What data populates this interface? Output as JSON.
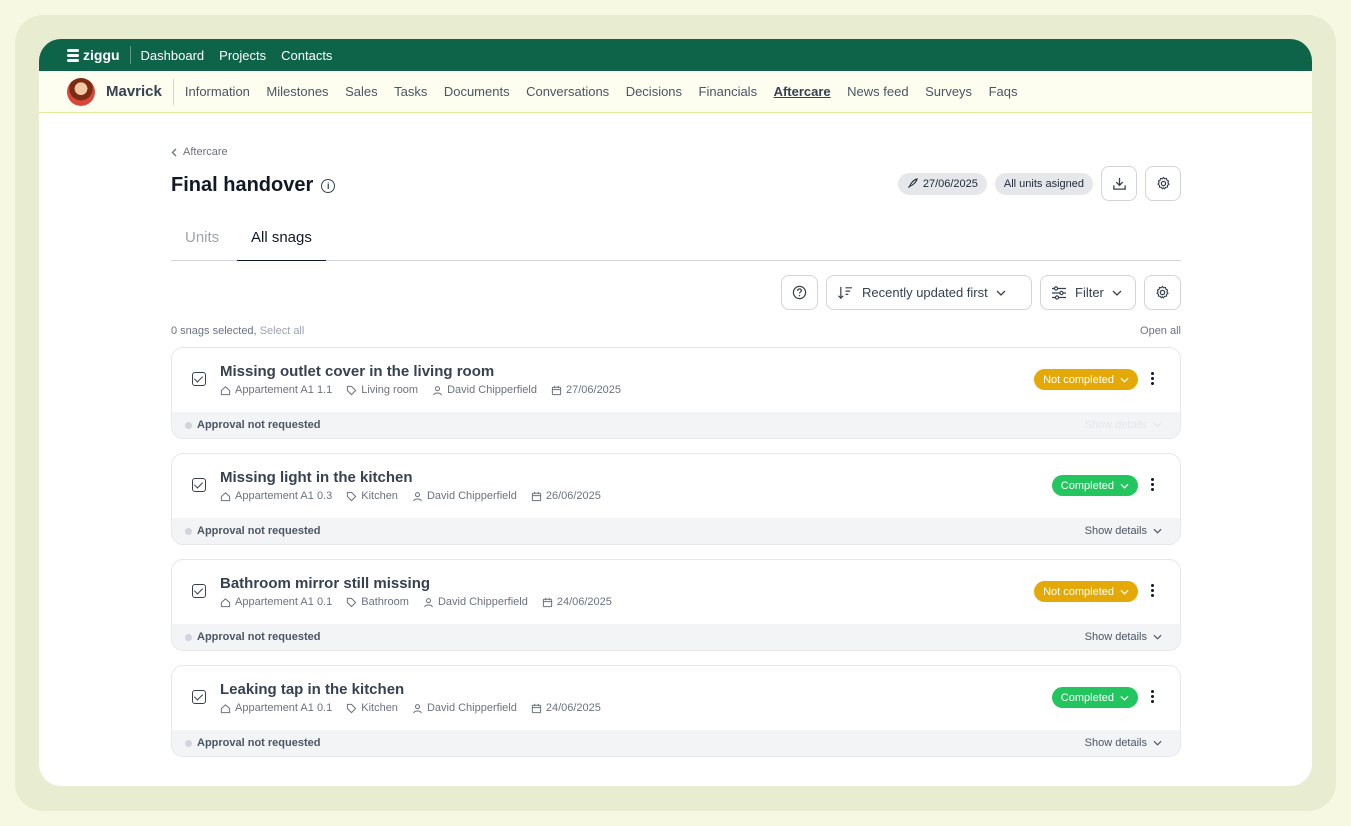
{
  "app": {
    "logo": "ziggu",
    "nav": [
      "Dashboard",
      "Projects",
      "Contacts"
    ]
  },
  "project": {
    "name": "Mavrick",
    "nav": [
      "Information",
      "Milestones",
      "Sales",
      "Tasks",
      "Documents",
      "Conversations",
      "Decisions",
      "Financials",
      "Aftercare",
      "News feed",
      "Surveys",
      "Faqs"
    ],
    "active": "Aftercare"
  },
  "breadcrumb": "Aftercare",
  "page": {
    "title": "Final handover",
    "date": "27/06/2025",
    "assigned": "All units asigned"
  },
  "tabs": {
    "units": "Units",
    "all_snags": "All snags"
  },
  "toolbar": {
    "sort": "Recently updated first",
    "filter": "Filter"
  },
  "selection": {
    "count": "0 snags selected,",
    "select_all": "Select all",
    "open_all": "Open all"
  },
  "snags": [
    {
      "title": "Missing outlet cover in the living room",
      "unit": "Appartement A1 1.1",
      "room": "Living room",
      "person": "David Chipperfield",
      "date": "27/06/2025",
      "status": "Not completed",
      "approval": "Approval not requested",
      "details": "Show details"
    },
    {
      "title": "Missing light in the kitchen",
      "unit": "Appartement A1 0.3",
      "room": "Kitchen",
      "person": "David Chipperfield",
      "date": "26/06/2025",
      "status": "Completed",
      "approval": "Approval not requested",
      "details": "Show details"
    },
    {
      "title": "Bathroom mirror still missing",
      "unit": "Appartement A1 0.1",
      "room": "Bathroom",
      "person": "David Chipperfield",
      "date": "24/06/2025",
      "status": "Not completed",
      "approval": "Approval not requested",
      "details": "Show details"
    },
    {
      "title": "Leaking tap in the kitchen",
      "unit": "Appartement A1 0.1",
      "room": "Kitchen",
      "person": "David Chipperfield",
      "date": "24/06/2025",
      "status": "Completed",
      "approval": "Approval not requested",
      "details": "Show details"
    }
  ],
  "colors": {
    "brand": "#0e6449",
    "not_completed": "#e4a906",
    "completed": "#22c55e"
  }
}
